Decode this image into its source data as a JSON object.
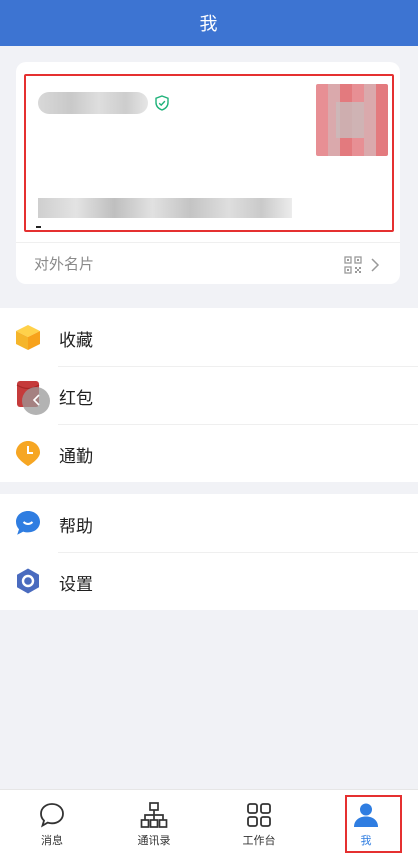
{
  "header": {
    "title": "我"
  },
  "profile": {
    "card_footer_label": "对外名片"
  },
  "menu_group_1": [
    {
      "label": "收藏",
      "icon": "box-icon"
    },
    {
      "label": "红包",
      "icon": "red-packet-icon"
    },
    {
      "label": "通勤",
      "icon": "clock-pin-icon"
    }
  ],
  "menu_group_2": [
    {
      "label": "帮助",
      "icon": "chat-bubble-icon"
    },
    {
      "label": "设置",
      "icon": "hexagon-gear-icon"
    }
  ],
  "tabbar": {
    "items": [
      {
        "label": "消息",
        "icon": "message-icon"
      },
      {
        "label": "通讯录",
        "icon": "org-chart-icon"
      },
      {
        "label": "工作台",
        "icon": "grid-icon"
      },
      {
        "label": "我",
        "icon": "person-icon"
      }
    ],
    "active_index": 3
  },
  "colors": {
    "header": "#3d74d2",
    "active": "#2f7de1",
    "highlight_border": "#e53030"
  }
}
